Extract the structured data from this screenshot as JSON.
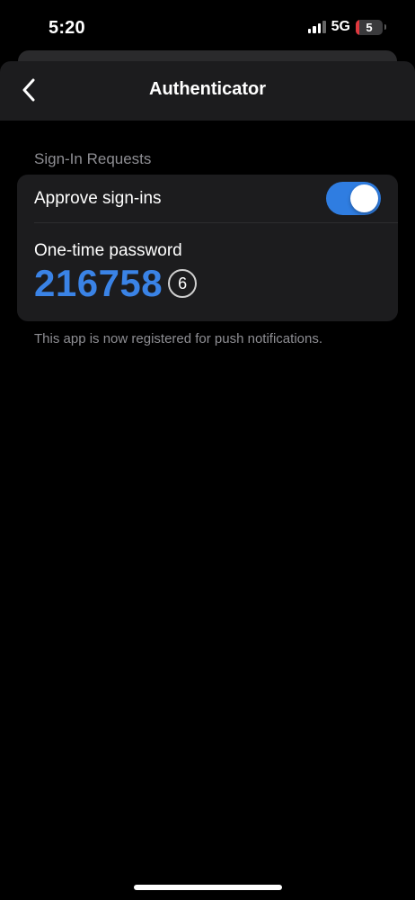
{
  "status_bar": {
    "time": "5:20",
    "network": "5G",
    "battery": "5",
    "battery_level": 0.05,
    "battery_color": "#e0383e"
  },
  "nav": {
    "title": "Authenticator",
    "back_icon": "chevron-left-icon"
  },
  "section": {
    "header": "Sign-In Requests",
    "approve_label": "Approve sign-ins",
    "approve_enabled": true,
    "otp_label": "One-time password",
    "otp_code": "216758",
    "otp_seconds": "6",
    "footer": "This app is now registered for push notifications."
  },
  "colors": {
    "accent": "#3a83e6",
    "toggle_on": "#2f7de1",
    "background": "#000000",
    "card": "#1c1c1e"
  }
}
